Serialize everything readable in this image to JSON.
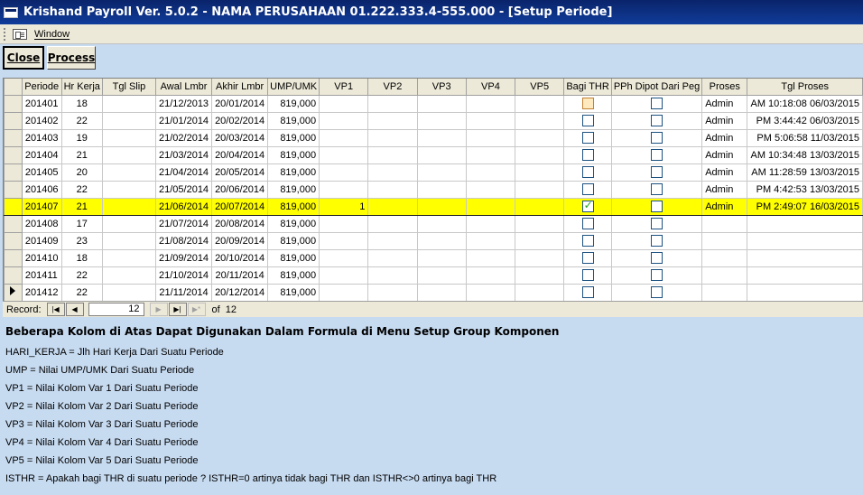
{
  "window": {
    "title": "Krishand Payroll Ver. 5.0.2 - NAMA PERUSAHAAN 01.222.333.4-555.000 - [Setup Periode]"
  },
  "menu": {
    "window_label": "Window"
  },
  "toolbar": {
    "close_label": "Close",
    "process_label": "Process"
  },
  "grid": {
    "columns": [
      "Periode",
      "Hr Kerja",
      "Tgl Slip",
      "Awal Lmbr",
      "Akhir Lmbr",
      "UMP/UMK",
      "VP1",
      "VP2",
      "VP3",
      "VP4",
      "VP5",
      "Bagi THR",
      "PPh Dipot Dari Peg",
      "Proses",
      "Tgl Proses"
    ],
    "rows": [
      {
        "periode": "201401",
        "hr_kerja": "18",
        "tgl_slip": "",
        "awal": "21/12/2013",
        "akhir": "20/01/2014",
        "ump": "819,000",
        "vp1": "",
        "bagi_thr": false,
        "pph": false,
        "proses": "Admin",
        "tgl_proses": "06/03/2015 10:18:08 AM"
      },
      {
        "periode": "201402",
        "hr_kerja": "22",
        "tgl_slip": "",
        "awal": "21/01/2014",
        "akhir": "20/02/2014",
        "ump": "819,000",
        "vp1": "",
        "bagi_thr": false,
        "pph": false,
        "proses": "Admin",
        "tgl_proses": "06/03/2015 3:44:42 PM"
      },
      {
        "periode": "201403",
        "hr_kerja": "19",
        "tgl_slip": "",
        "awal": "21/02/2014",
        "akhir": "20/03/2014",
        "ump": "819,000",
        "vp1": "",
        "bagi_thr": false,
        "pph": false,
        "proses": "Admin",
        "tgl_proses": "11/03/2015 5:06:58 PM"
      },
      {
        "periode": "201404",
        "hr_kerja": "21",
        "tgl_slip": "",
        "awal": "21/03/2014",
        "akhir": "20/04/2014",
        "ump": "819,000",
        "vp1": "",
        "bagi_thr": false,
        "pph": false,
        "proses": "Admin",
        "tgl_proses": "13/03/2015 10:34:48 AM"
      },
      {
        "periode": "201405",
        "hr_kerja": "20",
        "tgl_slip": "",
        "awal": "21/04/2014",
        "akhir": "20/05/2014",
        "ump": "819,000",
        "vp1": "",
        "bagi_thr": false,
        "pph": false,
        "proses": "Admin",
        "tgl_proses": "13/03/2015 11:28:59 AM"
      },
      {
        "periode": "201406",
        "hr_kerja": "22",
        "tgl_slip": "",
        "awal": "21/05/2014",
        "akhir": "20/06/2014",
        "ump": "819,000",
        "vp1": "",
        "bagi_thr": false,
        "pph": false,
        "proses": "Admin",
        "tgl_proses": "13/03/2015 4:42:53 PM"
      },
      {
        "periode": "201407",
        "hr_kerja": "21",
        "tgl_slip": "",
        "awal": "21/06/2014",
        "akhir": "20/07/2014",
        "ump": "819,000",
        "vp1": "1",
        "bagi_thr": true,
        "pph": false,
        "proses": "Admin",
        "tgl_proses": "16/03/2015 2:49:07 PM"
      },
      {
        "periode": "201408",
        "hr_kerja": "17",
        "tgl_slip": "",
        "awal": "21/07/2014",
        "akhir": "20/08/2014",
        "ump": "819,000",
        "vp1": "",
        "bagi_thr": false,
        "pph": false,
        "proses": "",
        "tgl_proses": ""
      },
      {
        "periode": "201409",
        "hr_kerja": "23",
        "tgl_slip": "",
        "awal": "21/08/2014",
        "akhir": "20/09/2014",
        "ump": "819,000",
        "vp1": "",
        "bagi_thr": false,
        "pph": false,
        "proses": "",
        "tgl_proses": ""
      },
      {
        "periode": "201410",
        "hr_kerja": "18",
        "tgl_slip": "",
        "awal": "21/09/2014",
        "akhir": "20/10/2014",
        "ump": "819,000",
        "vp1": "",
        "bagi_thr": false,
        "pph": false,
        "proses": "",
        "tgl_proses": ""
      },
      {
        "periode": "201411",
        "hr_kerja": "22",
        "tgl_slip": "",
        "awal": "21/10/2014",
        "akhir": "20/11/2014",
        "ump": "819,000",
        "vp1": "",
        "bagi_thr": false,
        "pph": false,
        "proses": "",
        "tgl_proses": ""
      },
      {
        "periode": "201412",
        "hr_kerja": "22",
        "tgl_slip": "",
        "awal": "21/11/2014",
        "akhir": "20/12/2014",
        "ump": "819,000",
        "vp1": "",
        "bagi_thr": false,
        "pph": false,
        "proses": "",
        "tgl_proses": ""
      }
    ],
    "highlight_row": 6,
    "current_row": 11,
    "highlight_color": "#ffff00"
  },
  "navigator": {
    "record_label": "Record:",
    "current": "12",
    "of_label": "of",
    "total": "12"
  },
  "notes": {
    "title": "Beberapa Kolom di Atas Dapat Digunakan Dalam Formula di Menu Setup Group Komponen",
    "lines": [
      "HARI_KERJA = Jlh Hari Kerja Dari Suatu Periode",
      "UMP = Nilai UMP/UMK Dari Suatu Periode",
      "VP1 =  Nilai Kolom Var 1 Dari Suatu Periode",
      "VP2 =  Nilai Kolom Var 2 Dari Suatu Periode",
      "VP3 =  Nilai Kolom Var 3 Dari Suatu Periode",
      "VP4 =  Nilai Kolom Var 4 Dari Suatu Periode",
      "VP5 =  Nilai Kolom Var 5 Dari Suatu Periode",
      "ISTHR = Apakah bagi THR di suatu periode ? ISTHR=0 artinya tidak bagi THR dan ISTHR<>0 artinya bagi THR"
    ]
  }
}
